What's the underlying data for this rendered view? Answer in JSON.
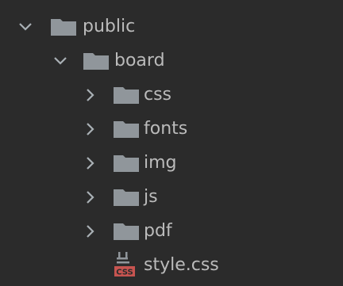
{
  "tree": {
    "root": {
      "label": "public",
      "icon": "folder-icon",
      "expanded": true
    },
    "child": {
      "label": "board",
      "icon": "folder-icon",
      "expanded": true
    },
    "folders": [
      {
        "label": "css",
        "icon": "folder-icon",
        "expanded": false
      },
      {
        "label": "fonts",
        "icon": "folder-icon",
        "expanded": false
      },
      {
        "label": "img",
        "icon": "folder-icon",
        "expanded": false
      },
      {
        "label": "js",
        "icon": "folder-icon",
        "expanded": false
      },
      {
        "label": "pdf",
        "icon": "folder-icon",
        "expanded": false
      }
    ],
    "file": {
      "label": "style.css",
      "icon": "css-file-icon",
      "badge": "CSS"
    }
  },
  "colors": {
    "background": "#2b2b2b",
    "text": "#bbbbbb",
    "folder": "#90969b",
    "chevron": "#a9b0b5",
    "css_badge": "#c75450"
  }
}
